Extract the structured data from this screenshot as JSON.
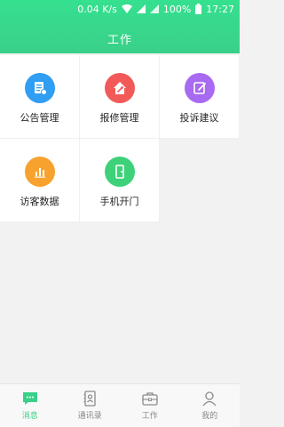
{
  "status_bar": {
    "speed": "0.04 K/s",
    "battery": "100%",
    "time": "17:27"
  },
  "header": {
    "title": "工作"
  },
  "colors": {
    "accent": "#38d089",
    "blue": "#2f9ef3",
    "red": "#f25a5a",
    "purple": "#a86af0",
    "orange": "#f7a22e",
    "green": "#3dd17a"
  },
  "tiles": [
    {
      "label": "公告管理",
      "icon": "announcement-icon",
      "color": "#2f9ef3"
    },
    {
      "label": "报修管理",
      "icon": "repair-home-icon",
      "color": "#f25a5a"
    },
    {
      "label": "投诉建议",
      "icon": "complaint-edit-icon",
      "color": "#a86af0"
    },
    {
      "label": "访客数据",
      "icon": "visitor-chart-icon",
      "color": "#f7a22e"
    },
    {
      "label": "手机开门",
      "icon": "door-open-icon",
      "color": "#3dd17a"
    }
  ],
  "bottom_nav": [
    {
      "label": "消息",
      "icon": "message-icon",
      "active": true
    },
    {
      "label": "通讯录",
      "icon": "contacts-icon",
      "active": false
    },
    {
      "label": "工作",
      "icon": "briefcase-icon",
      "active": false
    },
    {
      "label": "我的",
      "icon": "profile-icon",
      "active": false
    }
  ]
}
